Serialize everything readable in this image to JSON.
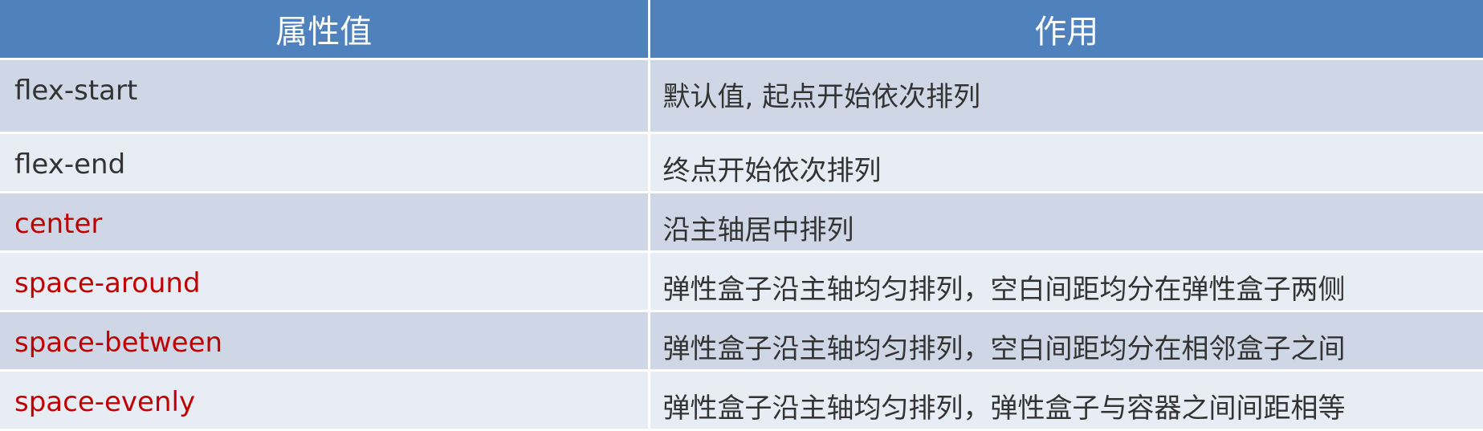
{
  "table": {
    "headers": [
      "属性值",
      "作用"
    ],
    "rows": [
      {
        "value": "flex-start",
        "value_color": "dark",
        "effect": "默认值, 起点开始依次排列"
      },
      {
        "value": "flex-end",
        "value_color": "dark",
        "effect": "终点开始依次排列"
      },
      {
        "value": "center",
        "value_color": "red",
        "effect": "沿主轴居中排列"
      },
      {
        "value": "space-around",
        "value_color": "red",
        "effect": "弹性盒子沿主轴均匀排列，空白间距均分在弹性盒子两侧"
      },
      {
        "value": "space-between",
        "value_color": "red",
        "effect": "弹性盒子沿主轴均匀排列，空白间距均分在相邻盒子之间"
      },
      {
        "value": "space-evenly",
        "value_color": "red",
        "effect": "弹性盒子沿主轴均匀排列，弹性盒子与容器之间间距相等"
      }
    ]
  },
  "colors": {
    "header_bg": "#4f81bd",
    "row_bg": "#cfd7e7",
    "row_alt_bg": "#e8ecf4",
    "text_dark": "#333333",
    "text_red": "#c00000"
  }
}
